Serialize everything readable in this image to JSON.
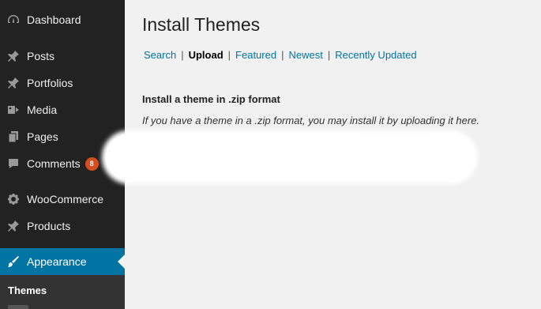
{
  "sidebar": {
    "items": [
      {
        "label": "Dashboard",
        "icon": "dashboard-icon"
      },
      {
        "label": "Posts",
        "icon": "pin-icon"
      },
      {
        "label": "Portfolios",
        "icon": "pin-icon"
      },
      {
        "label": "Media",
        "icon": "media-icon"
      },
      {
        "label": "Pages",
        "icon": "pages-icon"
      },
      {
        "label": "Comments",
        "icon": "comment-icon",
        "badge": "8"
      },
      {
        "label": "WooCommerce",
        "icon": "gear-icon"
      },
      {
        "label": "Products",
        "icon": "pin-icon"
      },
      {
        "label": "Appearance",
        "icon": "paintbrush-icon",
        "active": true
      }
    ],
    "submenu": {
      "current": "Themes"
    }
  },
  "main": {
    "title": "Install Themes",
    "tabs": [
      "Search",
      "Upload",
      "Featured",
      "Newest",
      "Recently Updated"
    ],
    "current_tab": "Upload",
    "upload": {
      "heading": "Install a theme in .zip format",
      "description": "If you have a theme in a .zip format, you may install it by uploading it here."
    }
  },
  "colors": {
    "sidebar_bg": "#222222",
    "active_bg": "#0074a2",
    "badge_bg": "#d54e21",
    "link": "#0074a2"
  }
}
